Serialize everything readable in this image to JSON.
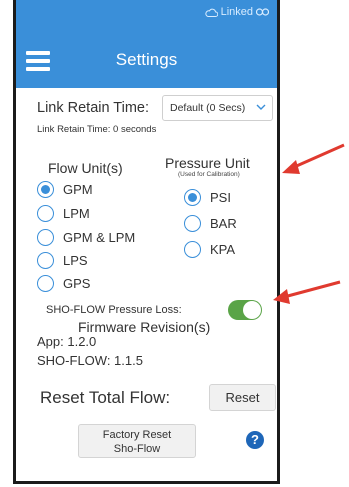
{
  "status": {
    "linked_text": "Linked"
  },
  "header": {
    "title": "Settings",
    "menu_icon": "hamburger-menu-icon"
  },
  "link_retain": {
    "label": "Link Retain Time:",
    "dropdown_value": "Default (0 Secs)",
    "current_text": "Link Retain Time: 0 seconds"
  },
  "flow_units": {
    "heading": "Flow Unit(s)",
    "options": [
      {
        "label": "GPM",
        "selected": true
      },
      {
        "label": "LPM",
        "selected": false
      },
      {
        "label": "GPM & LPM",
        "selected": false
      },
      {
        "label": "LPS",
        "selected": false
      },
      {
        "label": "GPS",
        "selected": false
      }
    ]
  },
  "pressure_unit": {
    "heading": "Pressure Unit",
    "subheading": "(Used for Calibration)",
    "options": [
      {
        "label": "PSI",
        "selected": true
      },
      {
        "label": "BAR",
        "selected": false
      },
      {
        "label": "KPA",
        "selected": false
      }
    ]
  },
  "pressure_loss": {
    "label": "SHO-FLOW Pressure Loss:",
    "enabled": true
  },
  "firmware": {
    "heading": "Firmware Revision(s)",
    "app_line": "App: 1.2.0",
    "shoflow_line": "SHO-FLOW: 1.1.5"
  },
  "reset_flow": {
    "label": "Reset Total Flow:",
    "button": "Reset"
  },
  "factory_reset": {
    "line1": "Factory Reset",
    "line2": "Sho-Flow"
  },
  "help": {
    "glyph": "?"
  },
  "colors": {
    "header": "#3a8fd9",
    "accent": "#3a8fd9",
    "toggle_on": "#5aa447",
    "arrow": "#e03a2f",
    "help": "#1e66b8"
  }
}
